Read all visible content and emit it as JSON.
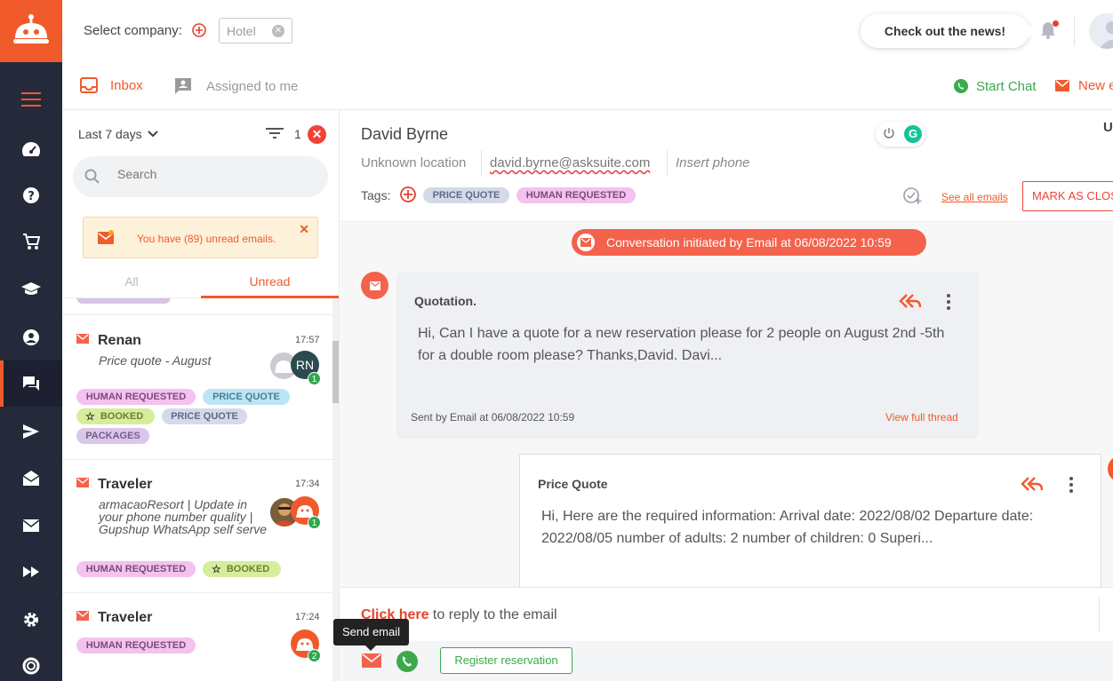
{
  "header": {
    "select_company_label": "Select company:",
    "company_chip": "Hotel",
    "news_button": "Check out the news!"
  },
  "subheader": {
    "inbox_tab": "Inbox",
    "assigned_tab": "Assigned to me",
    "start_chat": "Start Chat",
    "new_email": "New e"
  },
  "rail": {
    "icons": [
      "menu-icon",
      "dashboard-icon",
      "help-icon",
      "cart-icon",
      "graduation-cap-icon",
      "user-icon",
      "chat-icon",
      "send-icon",
      "mail-open-icon",
      "mail-icon",
      "fast-forward-icon",
      "gear-icon",
      "support-icon"
    ]
  },
  "list": {
    "period": "Last 7 days",
    "filter_count": "1",
    "search_placeholder": "Search",
    "unread_alert": "You have (89) unread emails.",
    "segment_all": "All",
    "segment_unread": "Unread",
    "conversations": [
      {
        "name": "Renan",
        "time": "17:57",
        "preview": "Price quote - August",
        "avatar_initials": "RN",
        "badge": "1",
        "tags": [
          "HUMAN REQUESTED",
          "PRICE QUOTE",
          "BOOKED",
          "PRICE QUOTE",
          "PACKAGES"
        ]
      },
      {
        "name": "Traveler",
        "time": "17:34",
        "preview": "armacaoResort | Update in your phone number quality | Gupshup WhatsApp self serve",
        "badge": "1",
        "tags": [
          "HUMAN REQUESTED",
          "BOOKED"
        ]
      },
      {
        "name": "Traveler",
        "time": "17:24",
        "badge": "2",
        "tags": [
          "HUMAN REQUESTED"
        ]
      }
    ]
  },
  "detail": {
    "contact_name": "David Byrne",
    "cut_text": "U",
    "location": "Unknown location",
    "email": "david.byrne@asksuite.com",
    "phone_placeholder": "Insert phone",
    "tags_label": "Tags:",
    "tags": [
      "PRICE QUOTE",
      "HUMAN REQUESTED"
    ],
    "see_all_emails": "See all emails",
    "mark_closed": "MARK AS CLOS",
    "init_notice": "Conversation initiated by Email at 06/08/2022 10:59",
    "messages": [
      {
        "subject": "Quotation.",
        "body": "Hi, Can I have a quote for a new reservation please for 2 people on August 2nd -5th for a double room please? Thanks,David. Davi...",
        "meta": "Sent by Email at 06/08/2022 10:59",
        "view_full_thread": "View full thread"
      },
      {
        "subject": "Price Quote",
        "body": "Hi, Here are the required information: Arrival date: 2022/08/02 Departure date: 2022/08/05 number of adults: 2 number of children: 0 Superi..."
      }
    ],
    "reply_link": "Click here",
    "reply_text": " to reply to the email",
    "register_reservation": "Register reservation",
    "tooltip": "Send email"
  },
  "colors": {
    "brand_orange": "#f15a2b",
    "rail_bg": "#252a3a",
    "whatsapp_green": "#3ca94b"
  }
}
